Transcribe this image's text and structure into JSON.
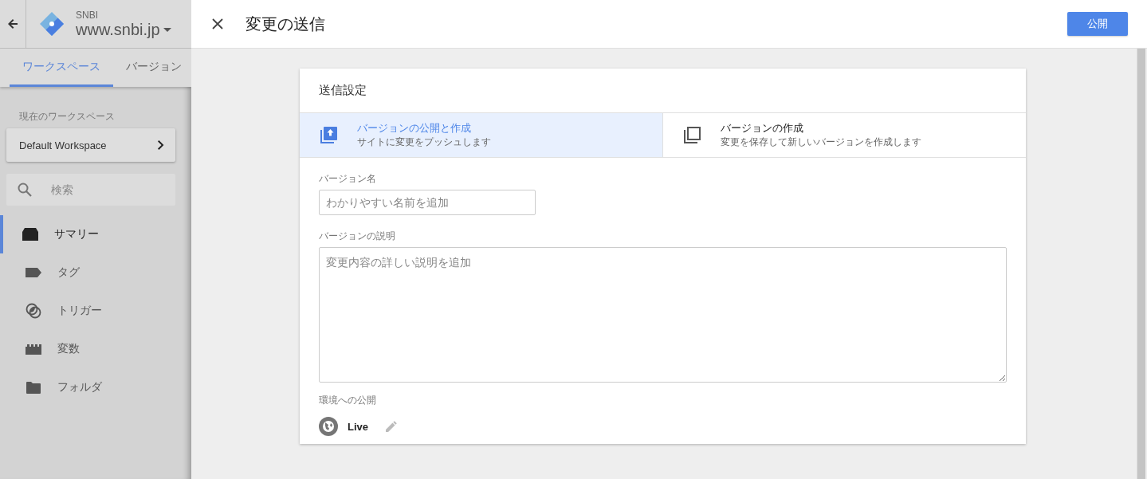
{
  "sidebar": {
    "account": "SNBI",
    "container": "www.snbi.jp",
    "tabs": [
      {
        "label": "ワークスペース",
        "selected": true
      },
      {
        "label": "バージョン",
        "selected": false
      }
    ],
    "workspace_label": "現在のワークスペース",
    "workspace": "Default Workspace",
    "search": {
      "placeholder": "検索"
    },
    "nav": [
      {
        "label": "サマリー",
        "kind": "summary",
        "selected": true
      },
      {
        "label": "タグ",
        "kind": "tag",
        "selected": false
      },
      {
        "label": "トリガー",
        "kind": "trigger",
        "selected": false
      },
      {
        "label": "変数",
        "kind": "variable",
        "selected": false
      },
      {
        "label": "フォルダ",
        "kind": "folder",
        "selected": false
      }
    ]
  },
  "dialog": {
    "title": "変更の送信",
    "publish_button": "公開",
    "section_title": "送信設定",
    "options": [
      {
        "title": "バージョンの公開と作成",
        "subtitle": "サイトに変更をプッシュします",
        "kind": "publish",
        "selected": true
      },
      {
        "title": "バージョンの作成",
        "subtitle": "変更を保存して新しいバージョンを作成します",
        "kind": "copy",
        "selected": false
      }
    ],
    "fields": [
      {
        "kind": "input",
        "label": "バージョン名",
        "placeholder": "わかりやすい名前を追加"
      },
      {
        "kind": "textarea",
        "label": "バージョンの説明",
        "placeholder": "変更内容の詳しい説明を追加"
      }
    ],
    "environment": {
      "label": "環境への公開",
      "name": "Live"
    }
  }
}
